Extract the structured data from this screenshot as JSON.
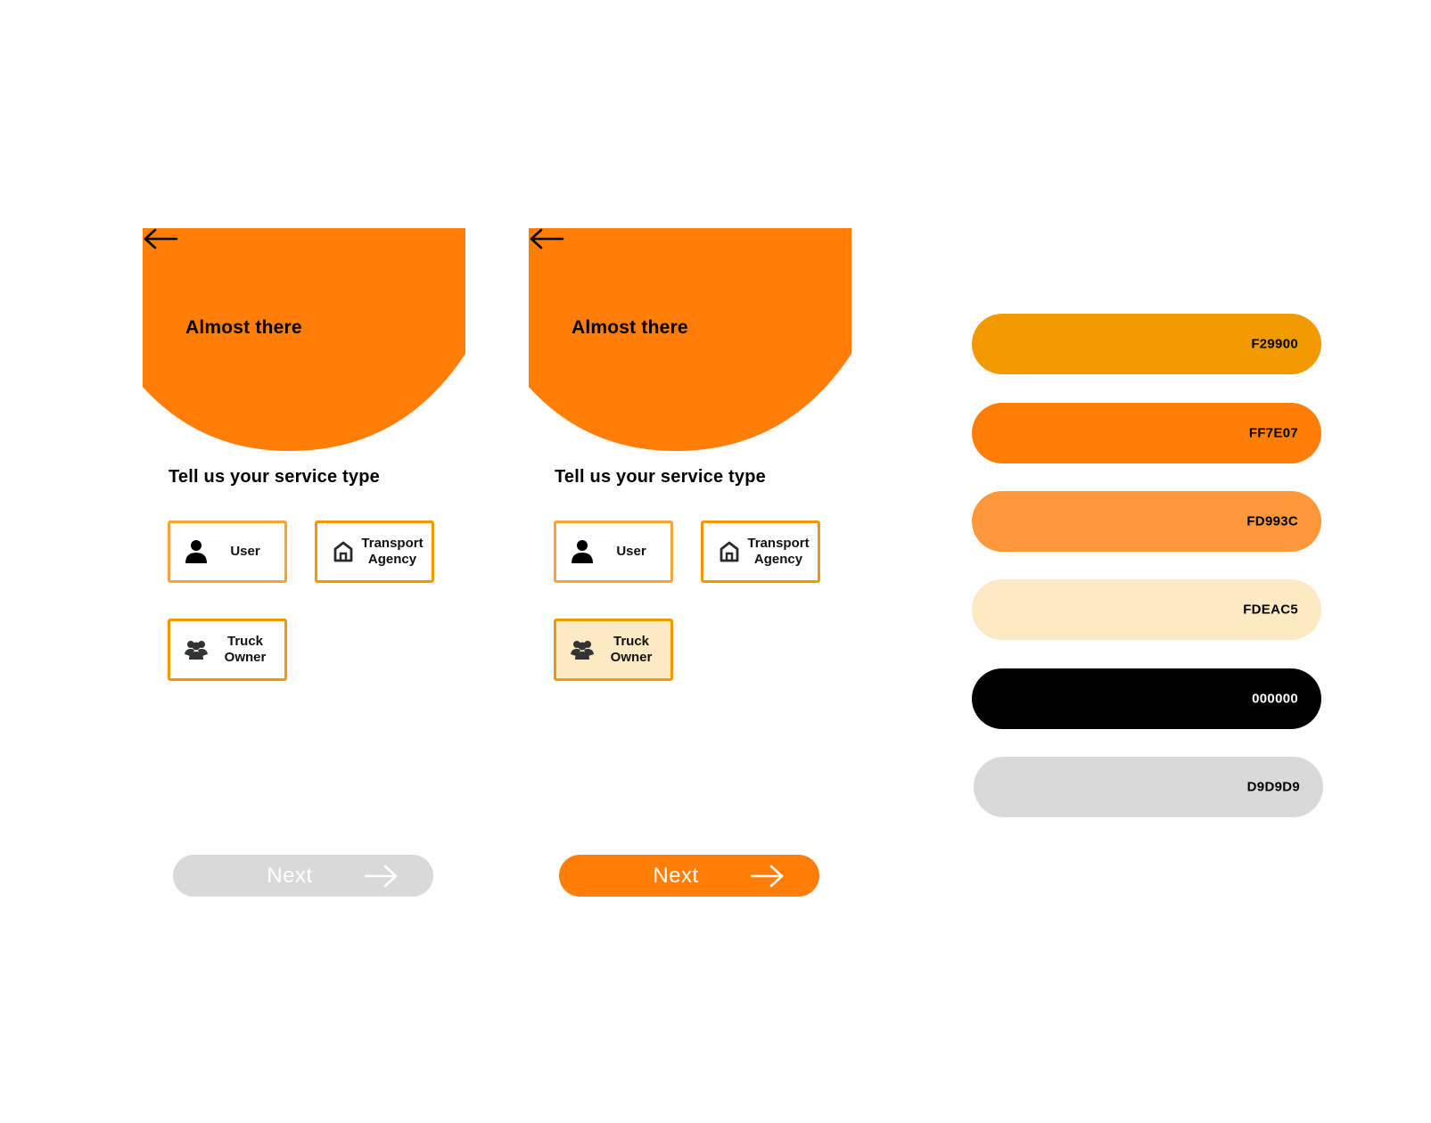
{
  "screens": [
    {
      "header_title": "Almost there",
      "section_heading": "Tell us your service type",
      "options": {
        "user": "User",
        "agency_line1": "Transport",
        "agency_line2": "Agency",
        "truck_line1": "Truck",
        "truck_line2": "Owner"
      },
      "selected": "none",
      "next_label": "Next",
      "next_state": "disabled"
    },
    {
      "header_title": "Almost there",
      "section_heading": "Tell us your service type",
      "options": {
        "user": "User",
        "agency_line1": "Transport",
        "agency_line2": "Agency",
        "truck_line1": "Truck",
        "truck_line2": "Owner"
      },
      "selected": "truck-owner",
      "next_label": "Next",
      "next_state": "active"
    }
  ],
  "icons": {
    "back": "arrow-left-icon",
    "user": "user-icon",
    "agency": "home-icon",
    "truck": "group-icon",
    "next": "arrow-right-icon"
  },
  "palette": [
    {
      "label": "F29900",
      "color": "#F29900",
      "text_color": "#000000"
    },
    {
      "label": "FF7E07",
      "color": "#FF7E07",
      "text_color": "#000000"
    },
    {
      "label": "FD993C",
      "color": "#FD993C",
      "text_color": "#000000"
    },
    {
      "label": "FDEAC5",
      "color": "#FDEAC5",
      "text_color": "#000000"
    },
    {
      "label": "000000",
      "color": "#000000",
      "text_color": "#FFFFFF"
    },
    {
      "label": "D9D9D9",
      "color": "#D9D9D9",
      "text_color": "#000000"
    }
  ]
}
